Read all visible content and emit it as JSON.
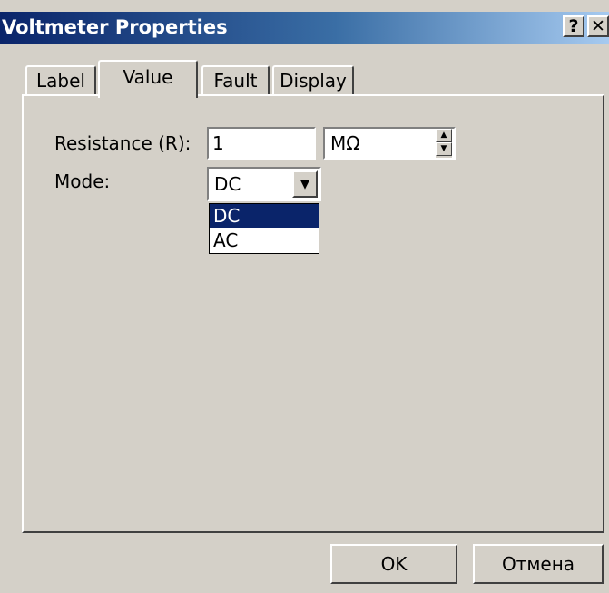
{
  "window": {
    "title": "Voltmeter Properties",
    "help_label": "?",
    "close_label": "✕"
  },
  "tabs": [
    {
      "label": "Label"
    },
    {
      "label": "Value"
    },
    {
      "label": "Fault"
    },
    {
      "label": "Display"
    }
  ],
  "active_tab": "Value",
  "fields": {
    "resistance": {
      "label": "Resistance (R):",
      "value": "1",
      "unit": "MΩ",
      "spin_up": "▲",
      "spin_down": "▼"
    },
    "mode": {
      "label": "Mode:",
      "value": "DC",
      "dropdown_icon": "▼",
      "options": [
        "DC",
        "AC"
      ],
      "highlighted": "DC"
    }
  },
  "buttons": {
    "ok": "OK",
    "cancel": "Отмена"
  },
  "colors": {
    "title_start": "#0a246a",
    "title_end": "#a6caf0",
    "face": "#d4d0c8",
    "highlight": "#0a246a"
  }
}
